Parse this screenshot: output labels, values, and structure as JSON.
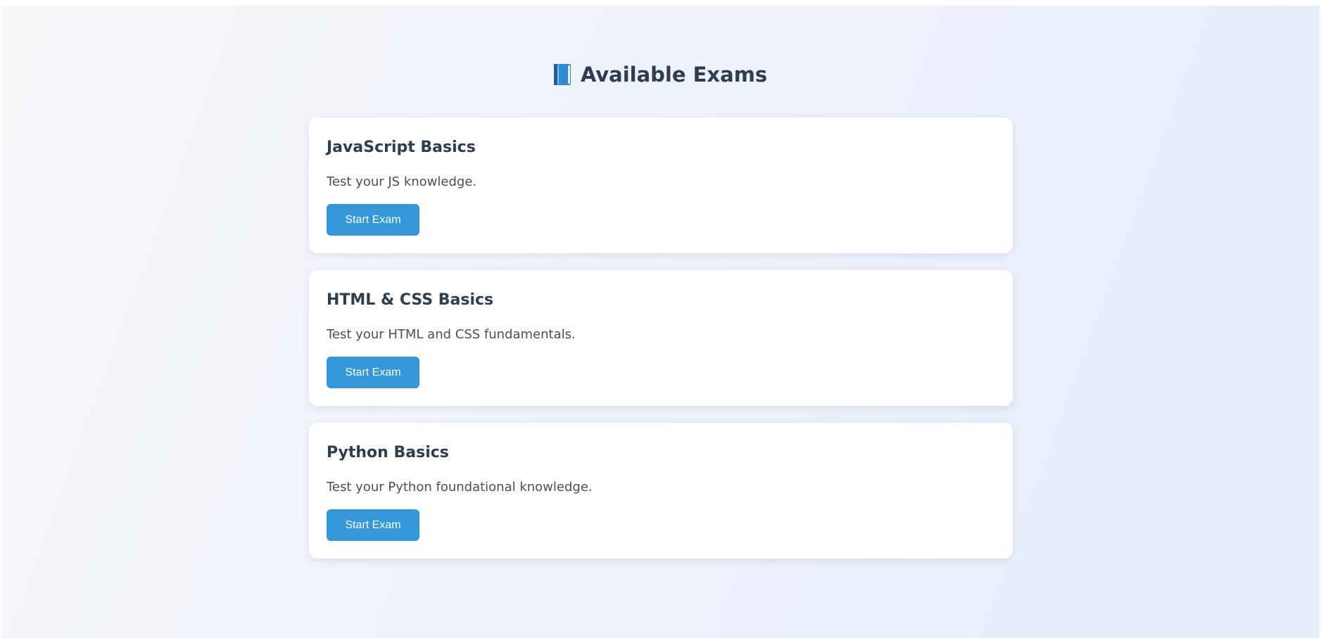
{
  "header": {
    "title": "Available Exams",
    "icon": "blue-book-icon"
  },
  "colors": {
    "accent": "#3498db",
    "heading": "#2c3e50",
    "text": "#4a4f57",
    "card": "#ffffff"
  },
  "exams": [
    {
      "title": "JavaScript Basics",
      "description": "Test your JS knowledge.",
      "button_label": "Start Exam"
    },
    {
      "title": "HTML & CSS Basics",
      "description": "Test your HTML and CSS fundamentals.",
      "button_label": "Start Exam"
    },
    {
      "title": "Python Basics",
      "description": "Test your Python foundational knowledge.",
      "button_label": "Start Exam"
    }
  ]
}
